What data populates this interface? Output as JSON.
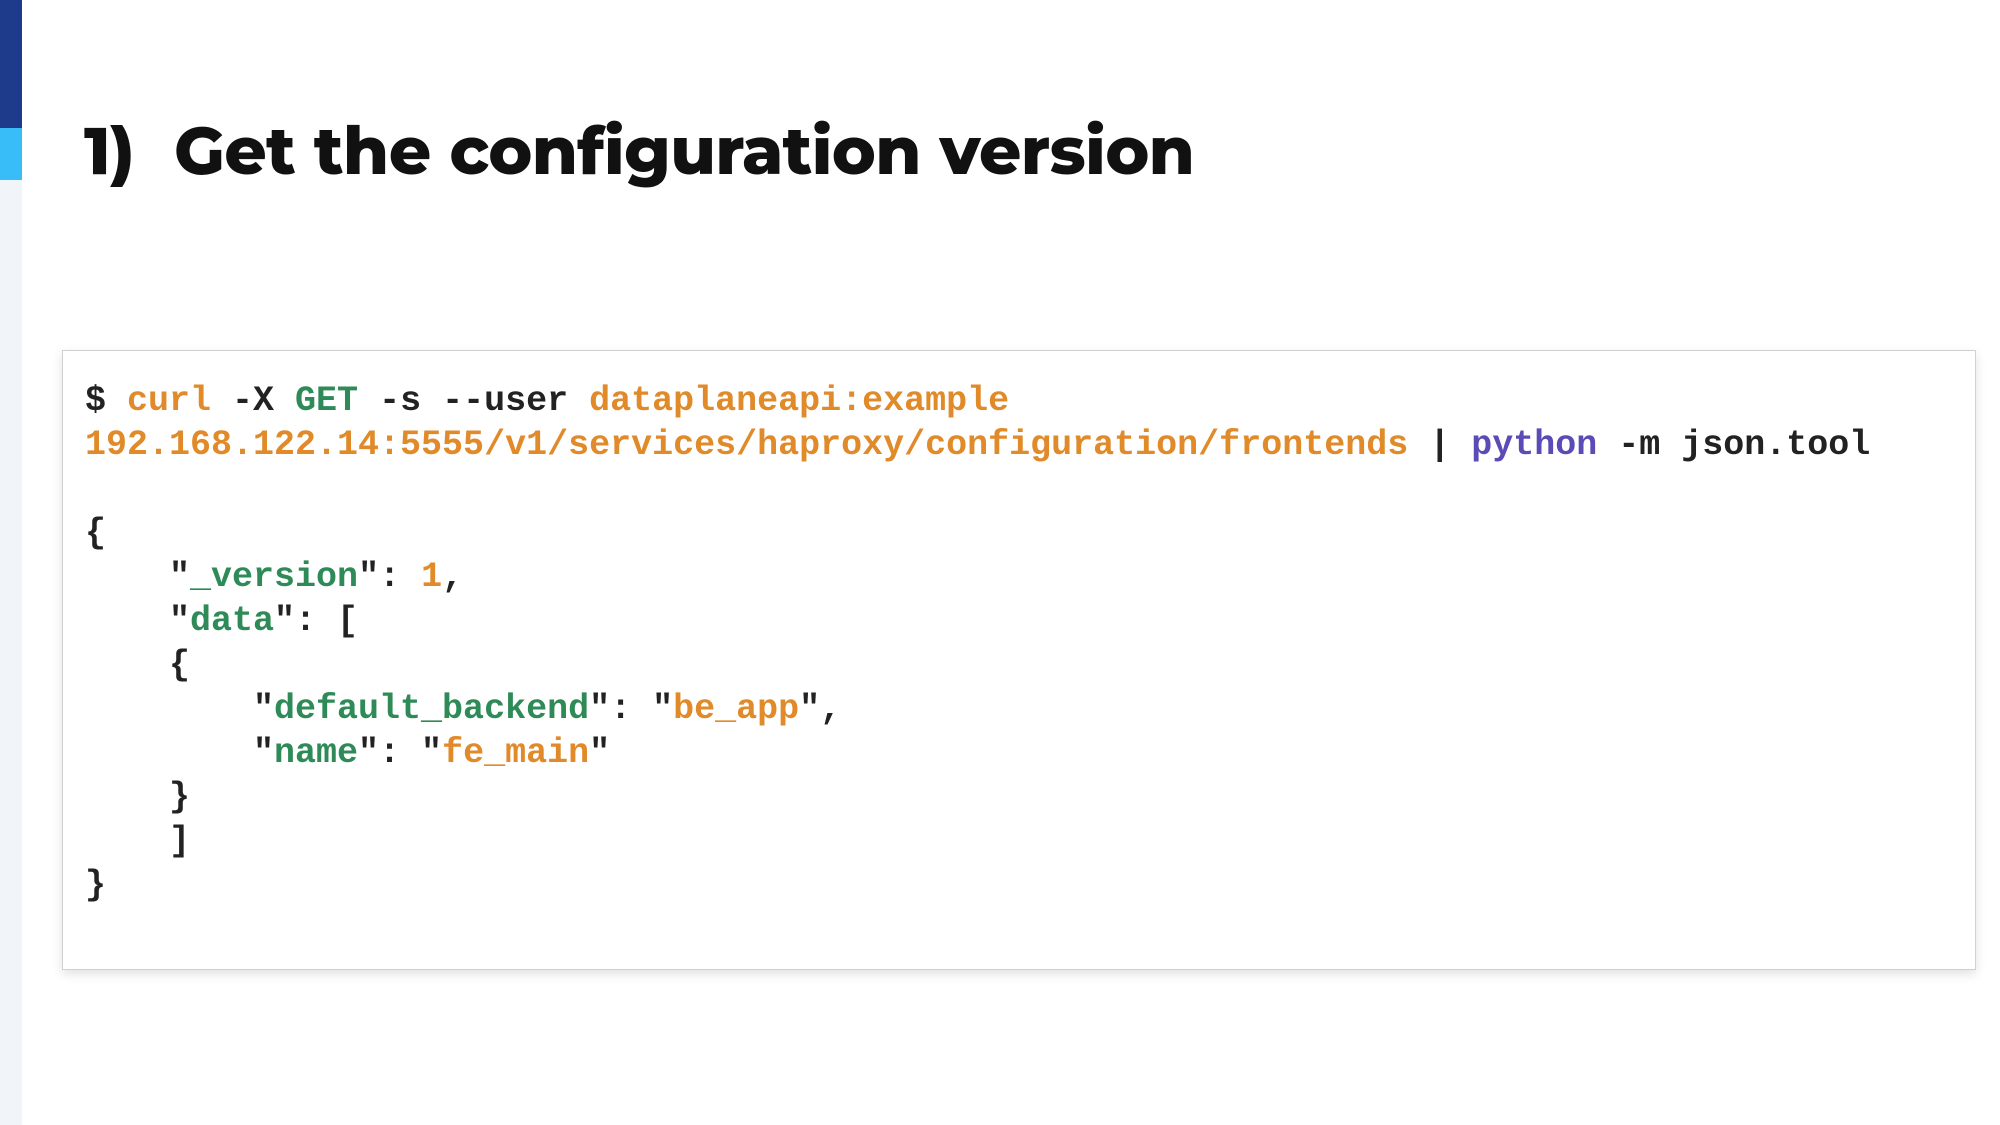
{
  "title_number": "1)",
  "title_text": "Get the configuration version",
  "code": {
    "prompt": "$ ",
    "curl": "curl",
    "dashX": " -X ",
    "get": "GET",
    "rest_flags": " -s --user ",
    "creds": "dataplaneapi:example",
    "url": "192.168.122.14:5555/v1/services/haproxy/configuration/frontends",
    "pipe_sep": " | ",
    "python": "python",
    "python_tail": " -m json.tool",
    "open_brace": "{",
    "blank": "",
    "l_version_open": "    \"",
    "l_version_key": "_version",
    "l_version_mid": "\": ",
    "l_version_val": "1",
    "l_version_end": ",",
    "l_data_open": "    \"",
    "l_data_key": "data",
    "l_data_tail": "\": [",
    "l_obj_open": "    {",
    "l_db_open": "        \"",
    "l_db_key": "default_backend",
    "l_db_mid": "\": \"",
    "l_db_val": "be_app",
    "l_db_end": "\",",
    "l_name_open": "        \"",
    "l_name_key": "name",
    "l_name_mid": "\": \"",
    "l_name_val": "fe_main",
    "l_name_end": "\"",
    "l_obj_close": "    }",
    "l_arr_close": "    ]",
    "close_brace": "}"
  }
}
